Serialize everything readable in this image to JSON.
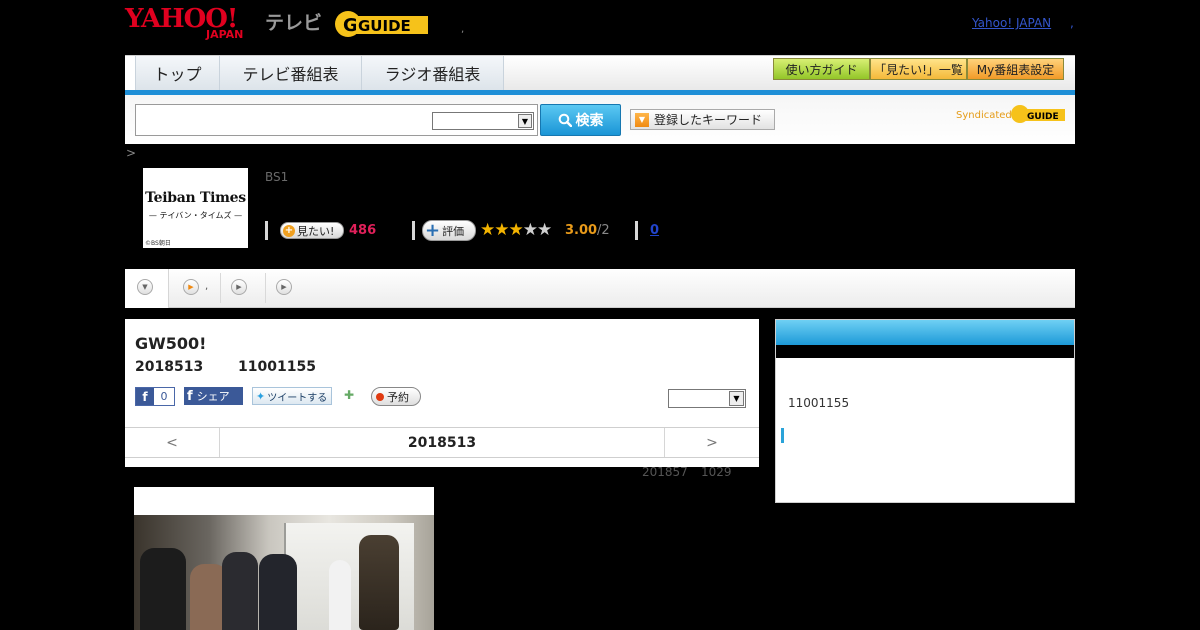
{
  "header": {
    "yahoo_logo": "YAHOO!",
    "yahoo_logo_sub": "JAPAN",
    "tv_label": "テレビ",
    "gguide_logo": "GUIDE",
    "dot": ",",
    "yahoo_japan_link": "Yahoo! JAPAN",
    "yahoo_japan_link_suffix": ","
  },
  "nav": {
    "tabs": [
      {
        "label": "トップ"
      },
      {
        "label": "テレビ番組表"
      },
      {
        "label": "ラジオ番組表"
      }
    ],
    "buttons": [
      {
        "label": "使い方ガイド"
      },
      {
        "label": "「見たい!」一覧"
      },
      {
        "label": "My番組表設定"
      }
    ]
  },
  "search": {
    "button_label": "検索",
    "keyword_button_label": "登録したキーワード",
    "syndicated": "Syndicated",
    "syndicated_logo": "GUIDE"
  },
  "breadcrumb": ">",
  "program": {
    "thumb_title": "Teiban Times",
    "thumb_sub": "— テイバン・タイムズ —",
    "thumb_copyright": "©BS朝日",
    "channel": "BS1",
    "mitai_label": "見たい!",
    "mitai_count": "486",
    "rate_label": "評価",
    "rating": 3,
    "rating_max": 5,
    "rate_value": "3.00",
    "rate_count": "/2",
    "comment_count": "0"
  },
  "tabstrip": {
    "dot": ","
  },
  "main": {
    "title": "GW500!",
    "date": "2018513",
    "time": "11001155",
    "fb_like_count": "0",
    "fb_share_label": "シェア",
    "tweet_label": "ツイートする",
    "reserve_label": "予約",
    "prev": "<",
    "nav_date": "2018513",
    "next": ">"
  },
  "update": {
    "date": "201857",
    "time": "1029"
  },
  "side": {
    "time": "11001155"
  },
  "colors": {
    "accent_blue": "#1f8fd7",
    "yahoo_red": "#e0001f",
    "mitai_pink": "#e0205a",
    "rating_orange": "#e89a1a",
    "star_gold": "#f4b400"
  }
}
